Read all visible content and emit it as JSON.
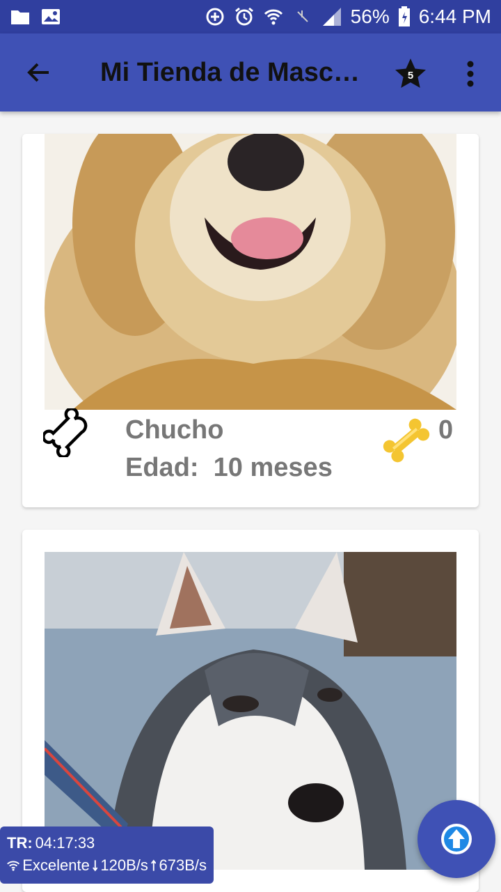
{
  "status_bar": {
    "battery": "56%",
    "time": "6:44 PM",
    "icons": [
      "folder-icon",
      "image-icon",
      "data-saver-icon",
      "alarm-icon",
      "wifi-icon",
      "mute-icon",
      "signal-icon",
      "battery-icon"
    ]
  },
  "app_bar": {
    "title": "Mi Tienda de Masc…",
    "star_count": "5",
    "icons": [
      "back-arrow-icon",
      "star-icon",
      "more-vert-icon"
    ]
  },
  "pets": [
    {
      "name": "Chucho",
      "age": "Edad:  10 meses",
      "likes": "0",
      "photo": "golden-retriever"
    },
    {
      "name": "",
      "age": "",
      "likes": "",
      "photo": "husky"
    }
  ],
  "network_overlay": {
    "tr_label": "TR:",
    "tr_value": "04:17:33",
    "quality": "Excelente",
    "download": "120B/s",
    "upload": "673B/s"
  },
  "colors": {
    "primary": "#3f51b5",
    "primary_dark": "#303f9f",
    "text_gray": "#777777",
    "bone_gold": "#f4c531"
  }
}
